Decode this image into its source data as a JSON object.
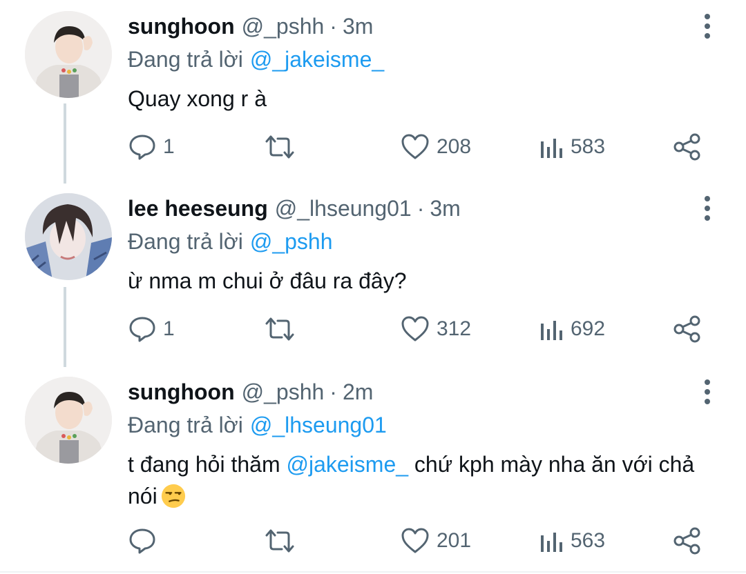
{
  "tweets": [
    {
      "name": "sunghoon",
      "handle": "@_pshh",
      "separator": "·",
      "time": "3m",
      "reply_prefix": "Đang trả lời",
      "reply_to": "@_jakeisme_",
      "body": "Quay xong r à",
      "counts": {
        "replies": "1",
        "likes": "208",
        "views": "583"
      }
    },
    {
      "name": "lee heeseung",
      "handle": "@_lhseung01",
      "separator": "·",
      "time": "3m",
      "reply_prefix": "Đang trả lời",
      "reply_to": "@_pshh",
      "body": "ừ nma m chui ở đâu ra đây?",
      "counts": {
        "replies": "1",
        "likes": "312",
        "views": "692"
      }
    },
    {
      "name": "sunghoon",
      "handle": "@_pshh",
      "separator": "·",
      "time": "2m",
      "reply_prefix": "Đang trả lời",
      "reply_to": "@_lhseung01",
      "body_before": "t đang hỏi thăm ",
      "body_mention": "@jakeisme_",
      "body_after": " chứ kph mày nha ăn với chả nói",
      "body_emoji": "unamused-face-emoji",
      "counts": {
        "replies": "",
        "likes": "201",
        "views": "563"
      }
    }
  ],
  "icons": {
    "reply": "speech-bubble-icon",
    "retweet": "retweet-icon",
    "like": "heart-icon",
    "views": "bar-chart-icon",
    "share": "share-icon",
    "more": "vertical-dots-icon"
  },
  "colors": {
    "text": "#0f1419",
    "secondary": "#536471",
    "link": "#1d9bf0",
    "thread_line": "#cfd9de"
  }
}
